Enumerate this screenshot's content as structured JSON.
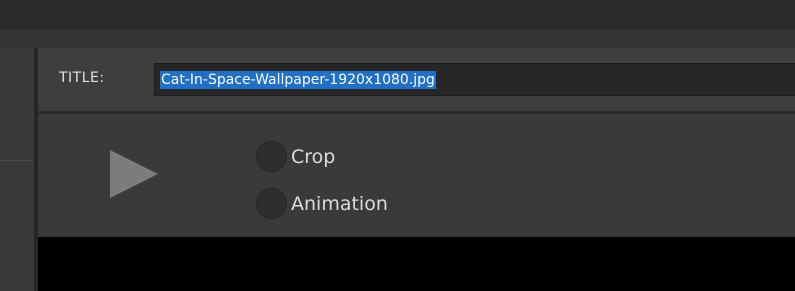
{
  "title_row": {
    "label": "TITLE:",
    "value": "Cat-In-Space-Wallpaper-1920x1080.jpg"
  },
  "controls": {
    "play_icon": "play-icon",
    "options": [
      {
        "label": "Crop",
        "selected": false
      },
      {
        "label": "Animation",
        "selected": false
      }
    ]
  },
  "colors": {
    "selection": "#1f70c8",
    "background": "#3a3a3a",
    "preview": "#000000"
  }
}
